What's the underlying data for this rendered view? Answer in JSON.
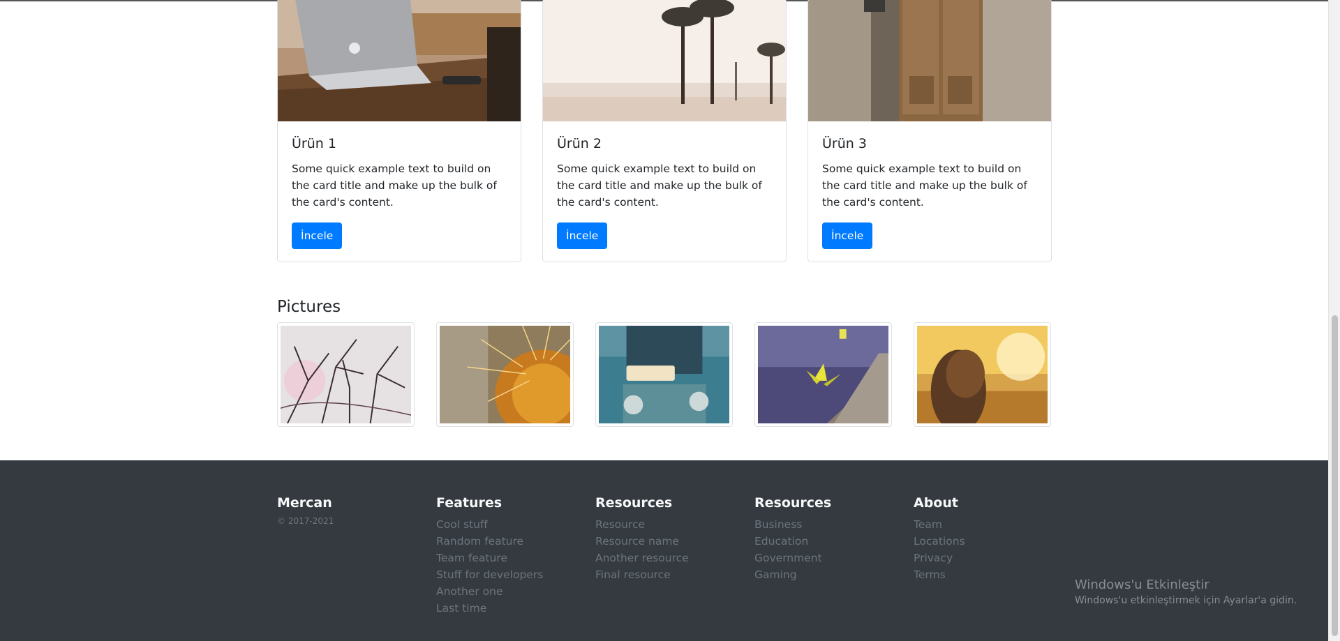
{
  "cards": [
    {
      "title": "Ürün 1",
      "text": "Some quick example text to build on the card title and make up the bulk of the card's content.",
      "button": "İncele"
    },
    {
      "title": "Ürün 2",
      "text": "Some quick example text to build on the card title and make up the bulk of the card's content.",
      "button": "İncele"
    },
    {
      "title": "Ürün 3",
      "text": "Some quick example text to build on the card title and make up the bulk of the card's content.",
      "button": "İncele"
    }
  ],
  "pictures": {
    "title": "Pictures"
  },
  "footer": {
    "brand": "Mercan",
    "copyright": "© 2017-2021",
    "columns": [
      {
        "heading": "Features",
        "links": [
          "Cool stuff",
          "Random feature",
          "Team feature",
          "Stuff for developers",
          "Another one",
          "Last time"
        ]
      },
      {
        "heading": "Resources",
        "links": [
          "Resource",
          "Resource name",
          "Another resource",
          "Final resource"
        ]
      },
      {
        "heading": "Resources",
        "links": [
          "Business",
          "Education",
          "Government",
          "Gaming"
        ]
      },
      {
        "heading": "About",
        "links": [
          "Team",
          "Locations",
          "Privacy",
          "Terms"
        ]
      }
    ]
  },
  "watermark": {
    "title": "Windows'u Etkinleştir",
    "subtitle": "Windows'u etkinleştirmek için Ayarlar'a gidin."
  },
  "colors": {
    "primary": "#007bff",
    "footer_bg": "#343a40",
    "muted": "#6c757d"
  }
}
